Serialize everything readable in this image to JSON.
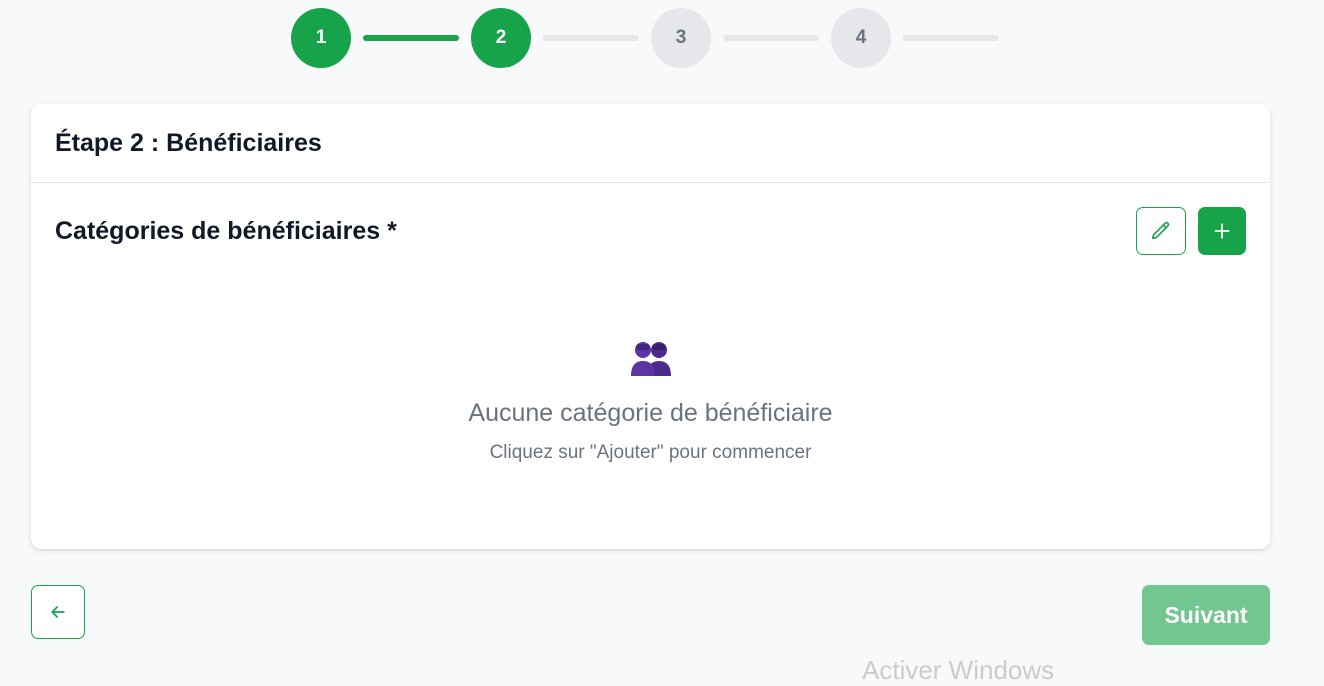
{
  "stepper": {
    "steps": [
      {
        "label": "1",
        "state": "completed"
      },
      {
        "label": "2",
        "state": "current"
      },
      {
        "label": "3",
        "state": "pending"
      },
      {
        "label": "4",
        "state": "pending"
      }
    ],
    "connectors": [
      "completed",
      "pending",
      "pending",
      "pending"
    ]
  },
  "card": {
    "title": "Étape 2 : Bénéficiaires"
  },
  "section": {
    "title": "Catégories de bénéficiaires *",
    "edit_icon": "pencil-icon",
    "add_icon": "plus-icon"
  },
  "empty_state": {
    "icon": "two-people-icon",
    "title": "Aucune catégorie de bénéficiaire",
    "hint": "Cliquez sur \"Ajouter\" pour commencer"
  },
  "nav": {
    "back_icon": "arrow-left-icon",
    "next_label": "Suivant"
  },
  "watermark": {
    "text": "Activer Windows"
  },
  "colors": {
    "accent": "#16a34a",
    "accent_disabled": "#73c690",
    "pending": "#e5e7eb",
    "muted_text": "#6b7280",
    "background": "#f8f9fa"
  }
}
